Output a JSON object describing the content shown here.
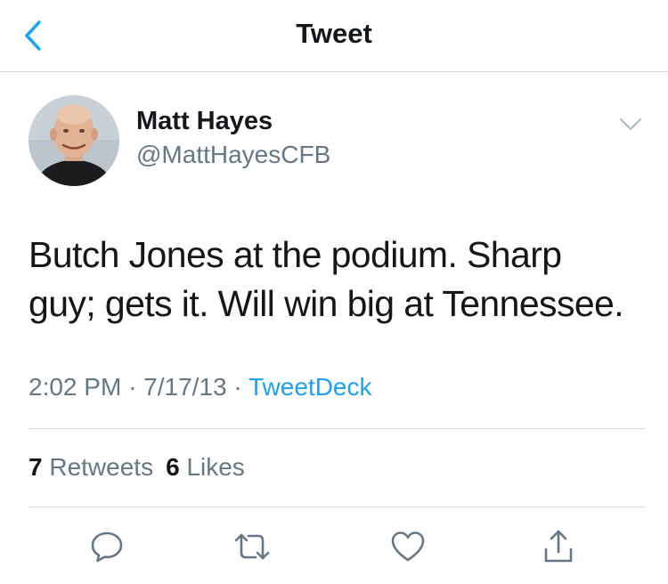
{
  "navbar": {
    "title": "Tweet",
    "back_icon": "chevron-left-icon"
  },
  "author": {
    "name": "Matt Hayes",
    "handle": "@MattHayesCFB",
    "avatar": "profile-photo"
  },
  "tweet": {
    "text_lines": [
      "Butch Jones at the podium. Sharp",
      "guy; gets it. Will win big at Tennessee."
    ],
    "time": "2:02 PM",
    "date": "7/17/13",
    "separator": "·",
    "source": "TweetDeck"
  },
  "stats": {
    "retweets_count": "7",
    "retweets_label": "Retweets",
    "likes_count": "6",
    "likes_label": "Likes"
  },
  "actions": [
    "reply-icon",
    "retweet-icon",
    "like-icon",
    "share-icon"
  ],
  "colors": {
    "accent": "#1da1f2",
    "text_primary": "#14171a",
    "text_secondary": "#657786",
    "divider": "#d9dde0"
  }
}
